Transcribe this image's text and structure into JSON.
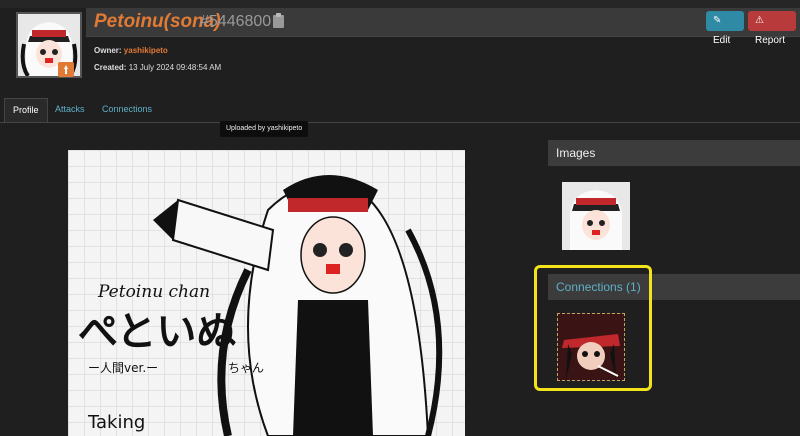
{
  "header": {
    "name": "Petoinu(sona)",
    "id": "#5446800",
    "edit_label": "Edit",
    "report_label": "Report"
  },
  "meta": {
    "owner_label": "Owner:",
    "owner_value": "yashikipeto",
    "created_label": "Created:",
    "created_value": "13 July 2024 09:48:54 AM"
  },
  "tabs": [
    {
      "label": "Profile",
      "active": true
    },
    {
      "label": "Attacks",
      "active": false
    },
    {
      "label": "Connections",
      "active": false
    }
  ],
  "tooltip": "Uploaded by yashikipeto",
  "images_panel": {
    "title": "Images"
  },
  "connections_panel": {
    "title": "Connections (1)"
  },
  "artwork_text": {
    "line1": "Petoinu chan",
    "line2": "ぺといぬ",
    "line3": "ちゃん",
    "line4": "ー人間ver.ー",
    "line5": "Taking"
  },
  "colors": {
    "accent_orange": "#e07a35",
    "link_teal": "#5fb0c7",
    "edit_btn": "#2f8aa6",
    "report_btn": "#b83a3a",
    "highlight": "#f2e31b"
  }
}
